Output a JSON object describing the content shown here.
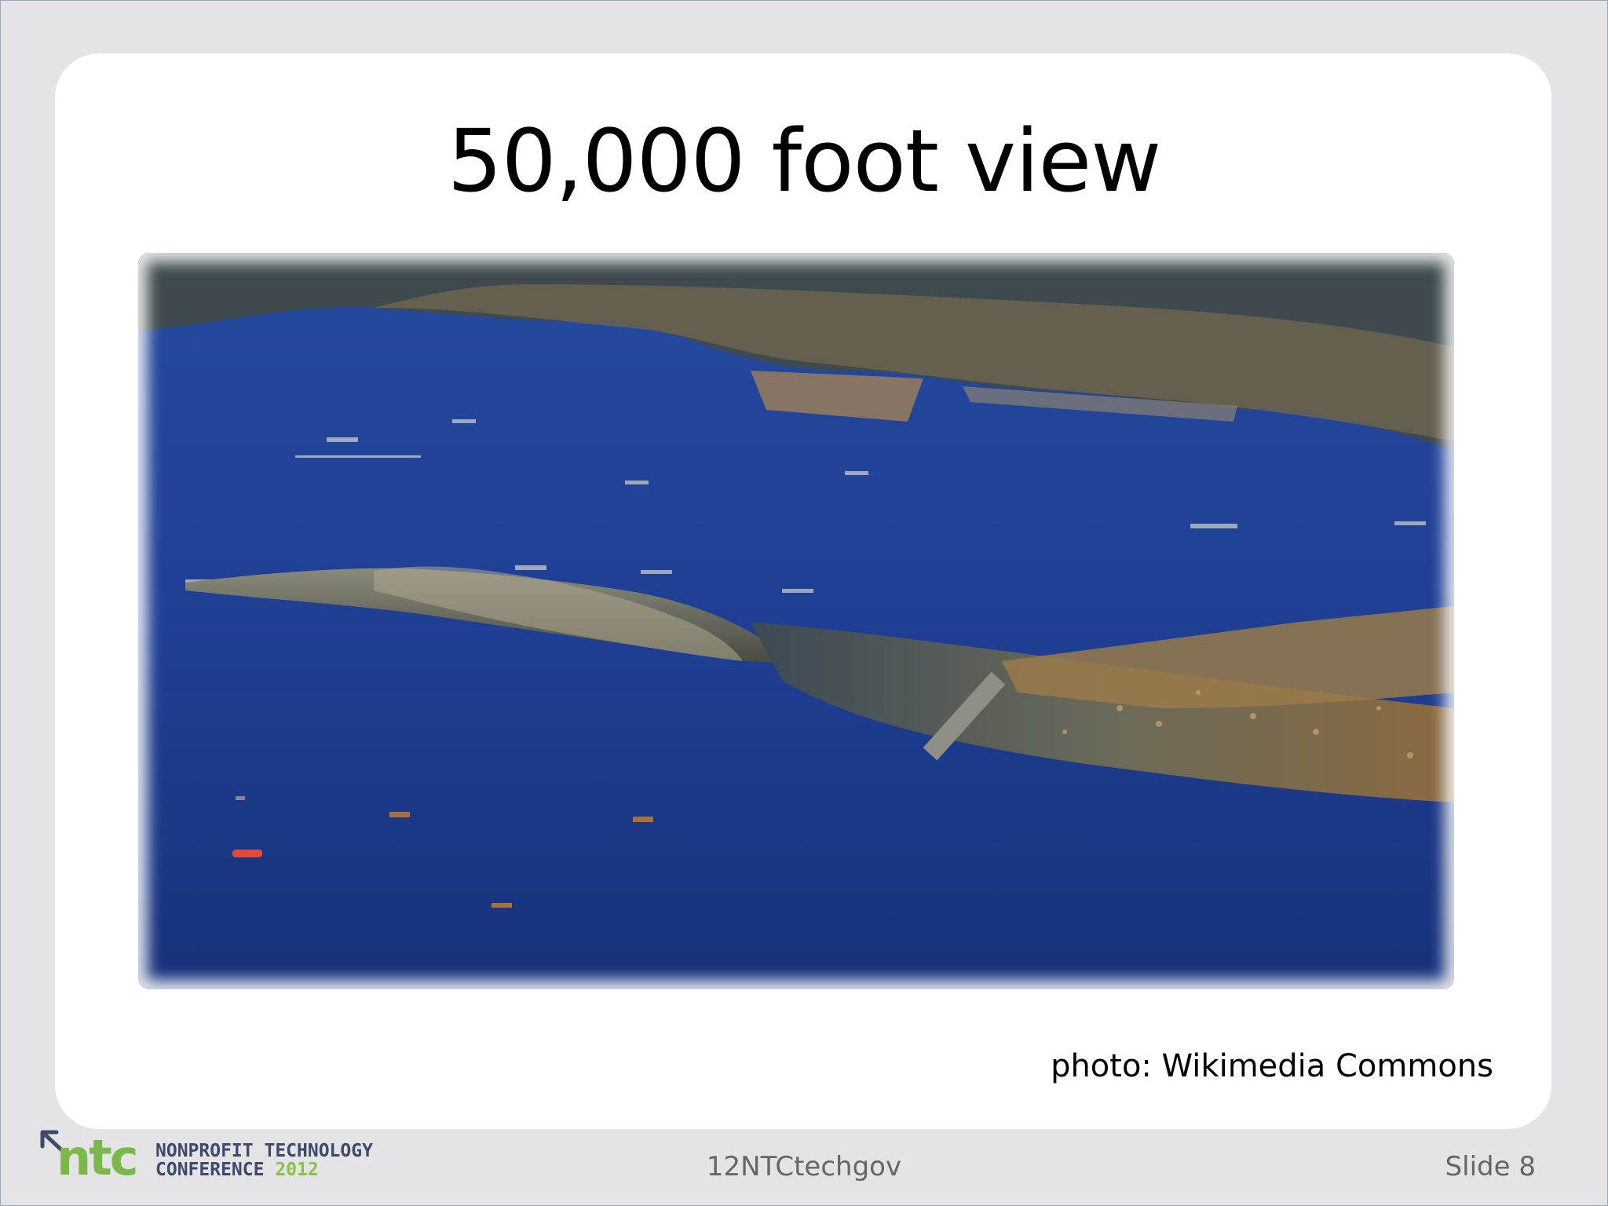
{
  "slide": {
    "title": "50,000 foot view",
    "photo_alt": "aerial photo",
    "credit": "photo: Wikimedia Commons",
    "footer_center": "12NTCtechgov",
    "footer_right": "Slide 8"
  },
  "logo": {
    "mark": "ntc",
    "line1": "NONPROFIT TECHNOLOGY",
    "line2_word": "CONFERENCE",
    "line2_year": "2012",
    "icon": "arrow-icon"
  },
  "colors": {
    "background": "#e4e4e6",
    "card": "#ffffff",
    "sea": "#1d3c8f",
    "logo_green": "#7ab84a",
    "logo_navy": "#3d4a6b"
  }
}
